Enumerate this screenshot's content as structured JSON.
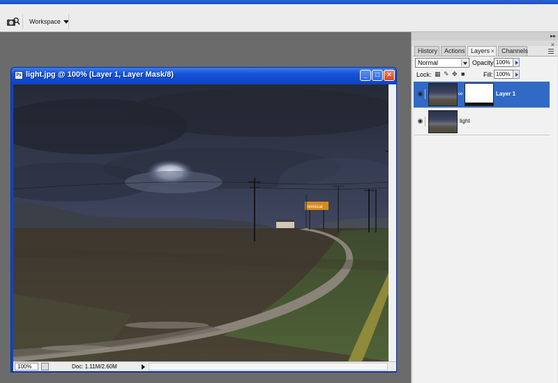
{
  "toolbar": {
    "workspace_label": "Workspace",
    "window_controls": [
      "–",
      "□",
      "×"
    ]
  },
  "document": {
    "title": "light.jpg @ 100% (Layer 1, Layer Mask/8)",
    "zoom": "100%",
    "doc_info": "Doc: 1.11M/2.60M",
    "photo_sign": "remiscal"
  },
  "layers_panel": {
    "tabs": [
      "History",
      "Actions",
      "Layers",
      "Channels"
    ],
    "active_tab": "Layers",
    "blend_mode": "Normal",
    "opacity_label": "Opacity:",
    "opacity_value": "100%",
    "lock_label": "Lock:",
    "fill_label": "Fill:",
    "fill_value": "100%",
    "layers": [
      {
        "name": "Layer 1",
        "selected": true,
        "has_mask": true
      },
      {
        "name": "light",
        "selected": false,
        "has_mask": false
      }
    ]
  },
  "colors": {
    "title_bar": "#0d45c9",
    "selection": "#316ac5",
    "workspace_bg": "#6b6b6b"
  }
}
